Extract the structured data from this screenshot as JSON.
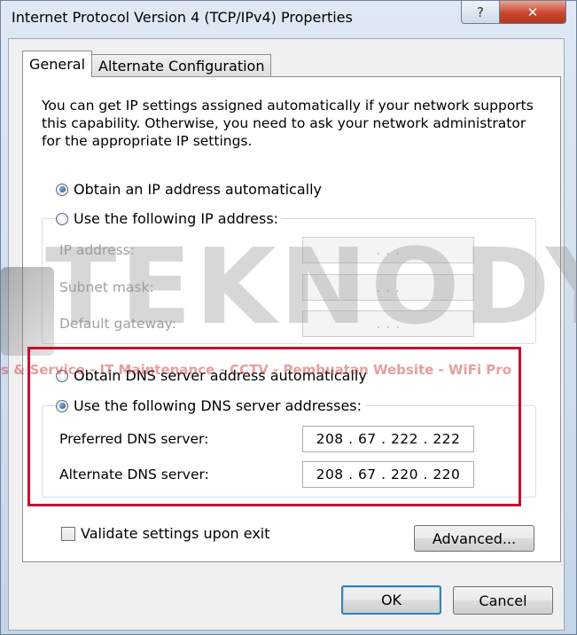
{
  "window": {
    "title": "Internet Protocol Version 4 (TCP/IPv4) Properties",
    "help_label": "?",
    "close_label": "✕"
  },
  "tabs": [
    {
      "label": "General",
      "active": true
    },
    {
      "label": "Alternate Configuration",
      "active": false
    }
  ],
  "intro_text": "You can get IP settings assigned automatically if your network supports this capability. Otherwise, you need to ask your network administrator for the appropriate IP settings.",
  "ip_section": {
    "auto_label": "Obtain an IP address automatically",
    "auto_selected": true,
    "manual_label": "Use the following IP address:",
    "manual_selected": false,
    "fields": [
      {
        "label": "IP address:",
        "value": " .  .  . "
      },
      {
        "label": "Subnet mask:",
        "value": " .  .  . "
      },
      {
        "label": "Default gateway:",
        "value": " .  .  . "
      }
    ]
  },
  "dns_section": {
    "auto_label": "Obtain DNS server address automatically",
    "auto_selected": false,
    "manual_label": "Use the following DNS server addresses:",
    "manual_selected": true,
    "fields": [
      {
        "label": "Preferred DNS server:",
        "value": "208 .  67  . 222 . 222"
      },
      {
        "label": "Alternate DNS server:",
        "value": "208 .  67  . 220 . 220"
      }
    ]
  },
  "validate": {
    "label": "Validate settings upon exit",
    "checked": false
  },
  "buttons": {
    "advanced": "Advanced...",
    "ok": "OK",
    "cancel": "Cancel"
  },
  "watermark": {
    "brand": "TEKNODY",
    "tagline": "s & Service - IT Maintenance - CCTV - Pembuatan Website - WiFi Pro"
  },
  "colors": {
    "highlight_border": "#c8102e",
    "default_button_border": "#3c7fb1"
  }
}
